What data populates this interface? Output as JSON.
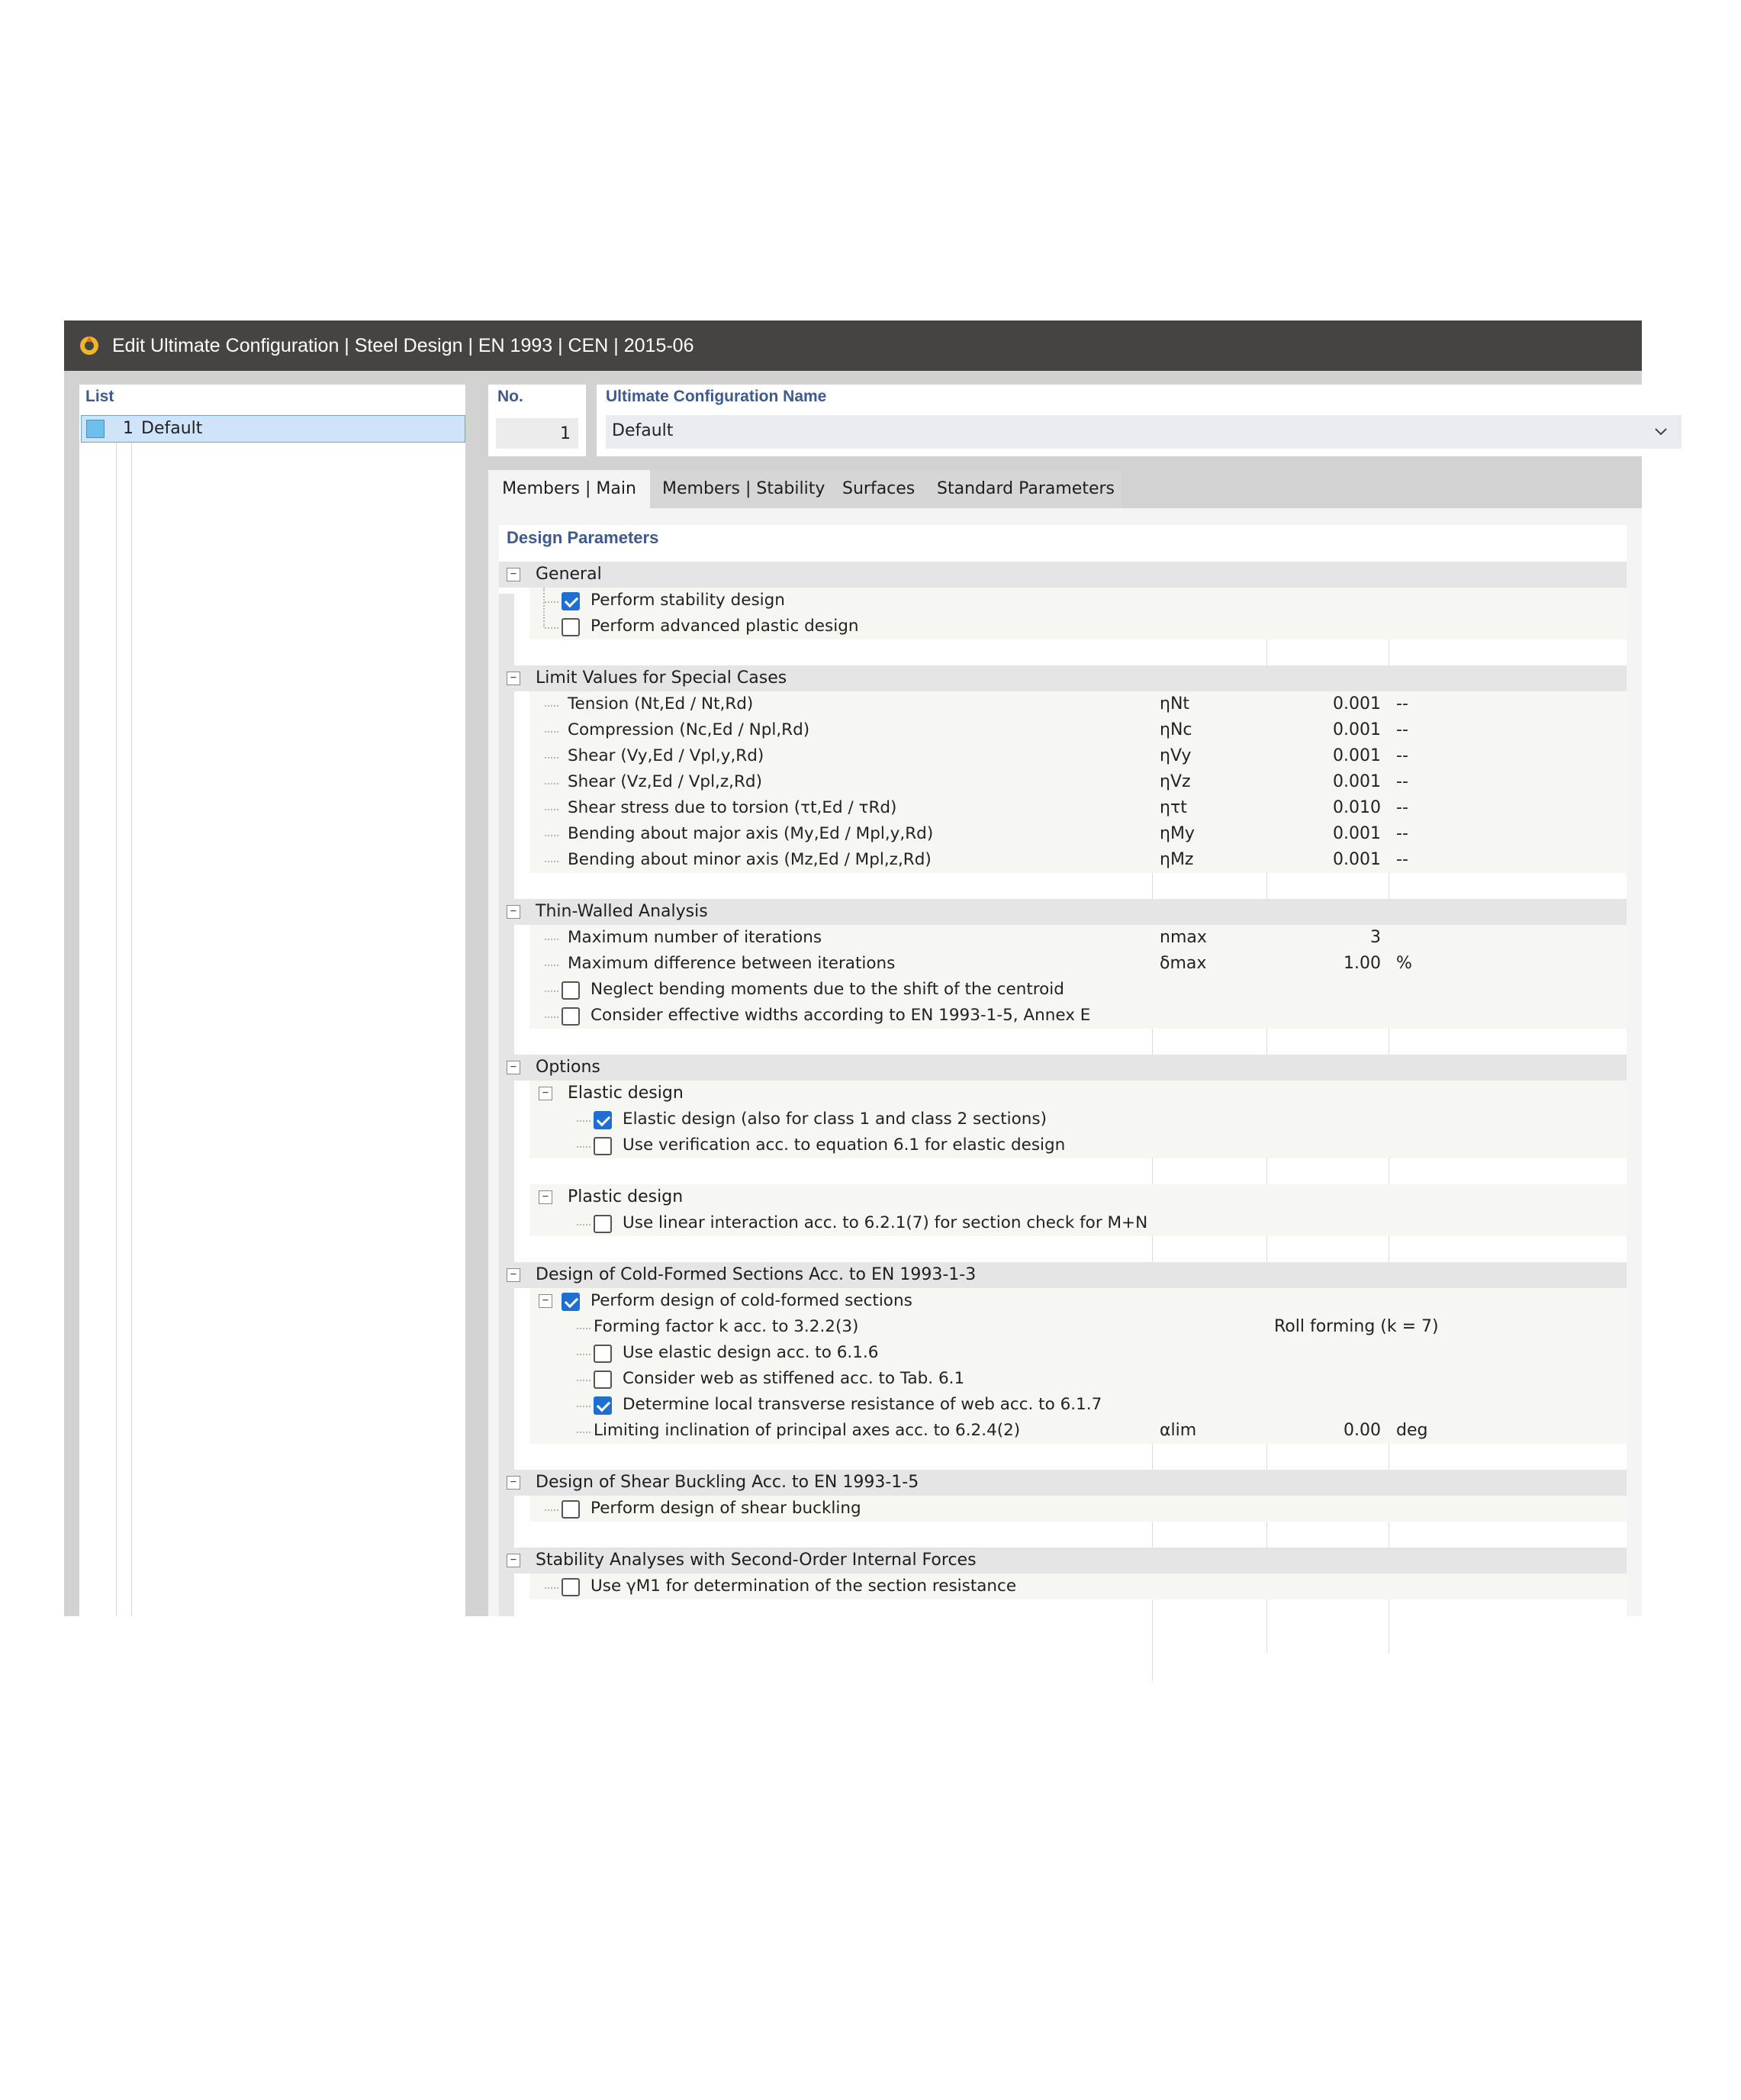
{
  "window": {
    "title": "Edit Ultimate Configuration | Steel Design | EN 1993 | CEN | 2015-06",
    "icon": "app-logo-icon"
  },
  "list": {
    "header": "List",
    "items": [
      {
        "number": "1",
        "name": "Default"
      }
    ]
  },
  "number": {
    "label": "No.",
    "value": "1"
  },
  "config_name": {
    "label": "Ultimate Configuration Name",
    "value": "Default"
  },
  "tabs": [
    {
      "label": "Members | Main",
      "active": true
    },
    {
      "label": "Members | Stability",
      "active": false
    },
    {
      "label": "Surfaces",
      "active": false
    },
    {
      "label": "Standard Parameters",
      "active": false
    }
  ],
  "design_parameters": {
    "title": "Design Parameters",
    "general": {
      "title": "General",
      "stability": {
        "label": "Perform stability design",
        "checked": true
      },
      "advanced_plastic": {
        "label": "Perform advanced plastic design",
        "checked": false
      }
    },
    "limits": {
      "title": "Limit Values for Special Cases",
      "rows": [
        {
          "label": "Tension (Nt,Ed / Nt,Rd)",
          "symbol": "ηNt",
          "value": "0.001",
          "unit": "--"
        },
        {
          "label": "Compression (Nc,Ed / Npl,Rd)",
          "symbol": "ηNc",
          "value": "0.001",
          "unit": "--"
        },
        {
          "label": "Shear (Vy,Ed / Vpl,y,Rd)",
          "symbol": "ηVy",
          "value": "0.001",
          "unit": "--"
        },
        {
          "label": "Shear (Vz,Ed / Vpl,z,Rd)",
          "symbol": "ηVz",
          "value": "0.001",
          "unit": "--"
        },
        {
          "label": "Shear stress due to torsion (τt,Ed / τRd)",
          "symbol": "ητt",
          "value": "0.010",
          "unit": "--"
        },
        {
          "label": "Bending about major axis (My,Ed / Mpl,y,Rd)",
          "symbol": "ηMy",
          "value": "0.001",
          "unit": "--"
        },
        {
          "label": "Bending about minor axis (Mz,Ed / Mpl,z,Rd)",
          "symbol": "ηMz",
          "value": "0.001",
          "unit": "--"
        }
      ]
    },
    "thin_walled": {
      "title": "Thin-Walled Analysis",
      "max_iter": {
        "label": "Maximum number of iterations",
        "symbol": "nmax",
        "value": "3",
        "unit": ""
      },
      "max_diff": {
        "label": "Maximum difference between iterations",
        "symbol": "δmax",
        "value": "1.00",
        "unit": "%"
      },
      "neglect_bending": {
        "label": "Neglect bending moments due to the shift of the centroid",
        "checked": false
      },
      "effective_widths": {
        "label": "Consider effective widths according to EN 1993-1-5, Annex E",
        "checked": false
      }
    },
    "options": {
      "title": "Options",
      "elastic": {
        "title": "Elastic design",
        "elastic_design": {
          "label": "Elastic design (also for class 1 and class 2 sections)",
          "checked": true
        },
        "eq_6_1": {
          "label": "Use verification acc. to equation 6.1 for elastic design",
          "checked": false
        }
      },
      "plastic": {
        "title": "Plastic design",
        "linear_interaction": {
          "label": "Use linear interaction acc. to 6.2.1(7) for section check for M+N",
          "checked": false
        }
      }
    },
    "cold_formed": {
      "title": "Design of Cold-Formed Sections Acc. to EN 1993-1-3",
      "perform": {
        "label": "Perform design of cold-formed sections",
        "checked": true
      },
      "forming_factor": {
        "label": "Forming factor k acc. to 3.2.2(3)",
        "value": "Roll forming (k = 7)"
      },
      "elastic_616": {
        "label": "Use elastic design acc. to 6.1.6",
        "checked": false
      },
      "stiffened_web": {
        "label": "Consider web as stiffened acc. to Tab. 6.1",
        "checked": false
      },
      "local_transverse": {
        "label": "Determine local transverse resistance of web acc. to 6.1.7",
        "checked": true
      },
      "limiting_inclination": {
        "label": "Limiting inclination of principal axes acc. to 6.2.4(2)",
        "symbol": "αlim",
        "value": "0.00",
        "unit": "deg"
      }
    },
    "shear_buckling": {
      "title": "Design of Shear Buckling Acc. to EN 1993-1-5",
      "perform": {
        "label": "Perform design of shear buckling",
        "checked": false
      }
    },
    "stability_second_order": {
      "title": "Stability Analyses with Second-Order Internal Forces",
      "gamma_m1": {
        "label": "Use γM1 for determination of the section resistance",
        "checked": false
      }
    }
  },
  "colors": {
    "titlebar": "#454442",
    "accent": "#3e5a8c",
    "checkbox_checked": "#1f6fd1",
    "selection": "#cfe4f8"
  }
}
